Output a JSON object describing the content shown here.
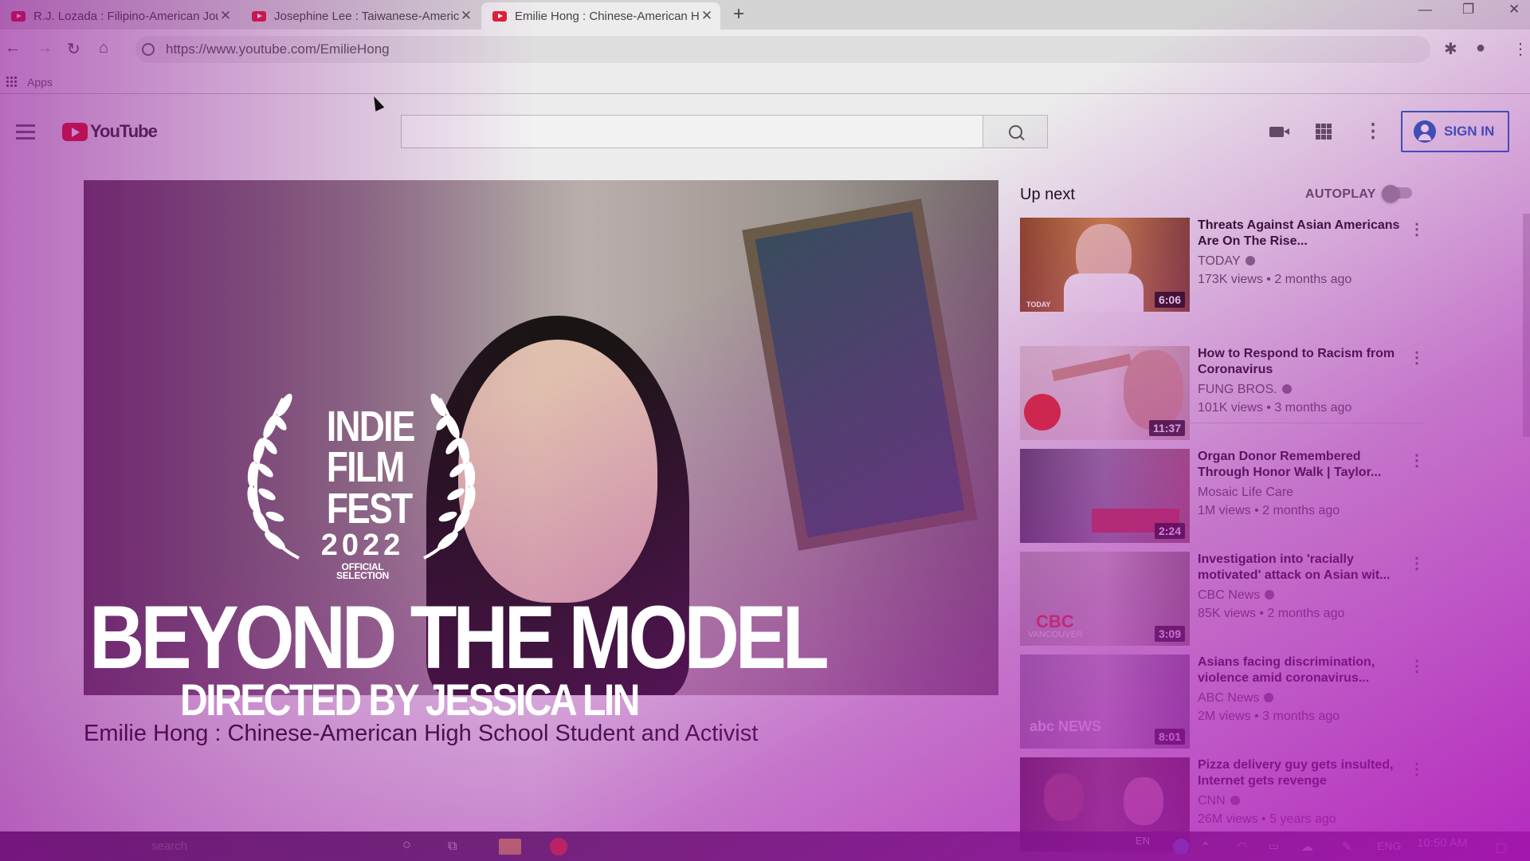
{
  "browser": {
    "tabs": [
      {
        "title": "R.J. Lozada : Filipino-American Jou",
        "active": false
      },
      {
        "title": "Josephine Lee : Taiwanese-Americ",
        "active": false
      },
      {
        "title": "Emilie Hong : Chinese-American Hi",
        "active": true
      }
    ],
    "new_tab": "+",
    "url": "https://www.youtube.com/EmilieHong",
    "bookmark_apps": "Apps"
  },
  "youtube": {
    "logo_text": "YouTube",
    "search_placeholder": "",
    "sign_in": "SIGN IN",
    "video_title": "Emilie Hong : Chinese-American High School Student and Activist",
    "up_next": "Up next",
    "autoplay": "AUTOPLAY",
    "autoplay_on": false,
    "recommendations": [
      {
        "title": "Threats Against Asian Americans Are On The Rise...",
        "channel": "TODAY",
        "verified": true,
        "meta": "173K views • 2 months ago",
        "duration": "6:06"
      },
      {
        "title": "How to Respond to Racism from Coronavirus",
        "channel": "FUNG BROS.",
        "verified": true,
        "meta": "101K views • 3 months ago",
        "duration": "11:37"
      },
      {
        "title": "Organ Donor Remembered Through Honor Walk | Taylor...",
        "channel": "Mosaic Life Care",
        "verified": false,
        "meta": "1M views • 2 months ago",
        "duration": "2:24"
      },
      {
        "title": "Investigation into 'racially motivated' attack on Asian wit...",
        "channel": "CBC News",
        "verified": true,
        "meta": "85K views • 2 months ago",
        "duration": "3:09"
      },
      {
        "title": "Asians facing discrimination, violence amid coronavirus...",
        "channel": "ABC News",
        "verified": true,
        "meta": "2M views • 3 months ago",
        "duration": "8:01"
      },
      {
        "title": "Pizza delivery guy gets insulted, Internet gets revenge",
        "channel": "CNN",
        "verified": true,
        "meta": "26M views • 5 years ago",
        "duration": ""
      }
    ]
  },
  "thumb_labels": {
    "today": "TODAY",
    "cbc": "CBC",
    "cbc_sub": "VANCOUVER",
    "abc": "abc NEWS"
  },
  "overlay": {
    "festival_line1": "INDIE",
    "festival_line2": "FILM",
    "festival_line3": "FEST",
    "festival_year": "2022",
    "festival_selection": "OFFICIAL SELECTION",
    "film_title": "BEYOND THE MODEL",
    "director": "DIRECTED BY JESSICA LIN"
  },
  "taskbar": {
    "lang_top": "EN",
    "lang": "ENG",
    "time": "10:50 AM",
    "search_hint": "search"
  },
  "colors": {
    "accent_overlay": "#b01cb8",
    "youtube_red": "#e02020",
    "signin_blue": "#1c62b9"
  }
}
